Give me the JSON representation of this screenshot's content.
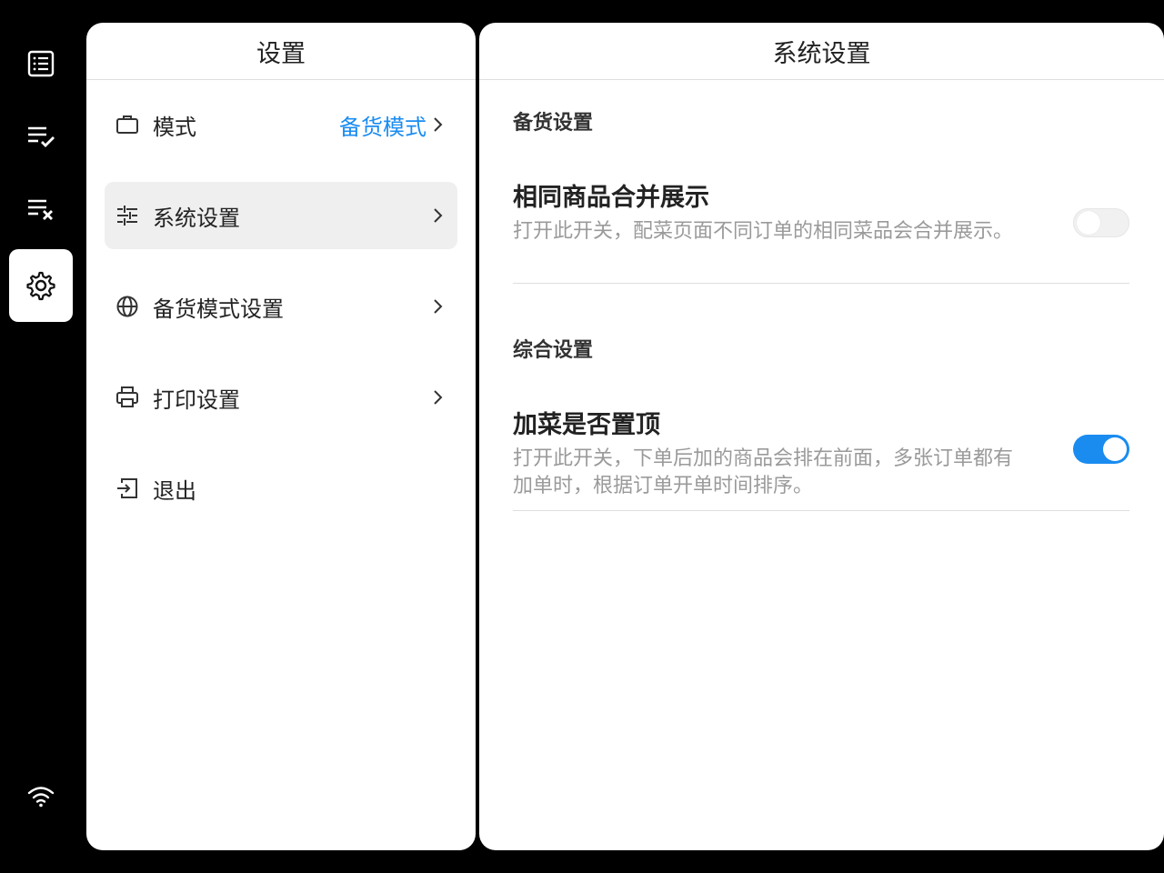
{
  "rail": {
    "items": [
      {
        "icon": "orders-list-icon"
      },
      {
        "icon": "completed-list-icon"
      },
      {
        "icon": "cancelled-list-icon"
      },
      {
        "icon": "settings-gear-icon",
        "active": true
      }
    ],
    "status_icon": "wifi-icon"
  },
  "left_panel": {
    "title": "设置",
    "items": [
      {
        "label": "模式",
        "value": "备货模式",
        "icon": "briefcase-icon"
      },
      {
        "label": "系统设置",
        "value": "",
        "icon": "sliders-icon",
        "selected": true
      },
      {
        "label": "备货模式设置",
        "value": "",
        "icon": "globe-icon"
      },
      {
        "label": "打印设置",
        "value": "",
        "icon": "printer-icon"
      },
      {
        "label": "退出",
        "value": "",
        "icon": "logout-icon"
      }
    ]
  },
  "right_panel": {
    "title": "系统设置",
    "sections": [
      {
        "title": "备货设置",
        "settings": [
          {
            "title": "相同商品合并展示",
            "desc": "打开此开关，配菜页面不同订单的相同菜品会合并展示。",
            "enabled": false
          }
        ]
      },
      {
        "title": "综合设置",
        "settings": [
          {
            "title": "加菜是否置顶",
            "desc": "打开此开关，下单后加的商品会排在前面，多张订单都有加单时，根据订单开单时间排序。",
            "enabled": true
          }
        ]
      }
    ]
  },
  "colors": {
    "accent": "#1a8cf0",
    "background": "#000000",
    "panel": "#ffffff",
    "selected_row": "#efefef"
  }
}
